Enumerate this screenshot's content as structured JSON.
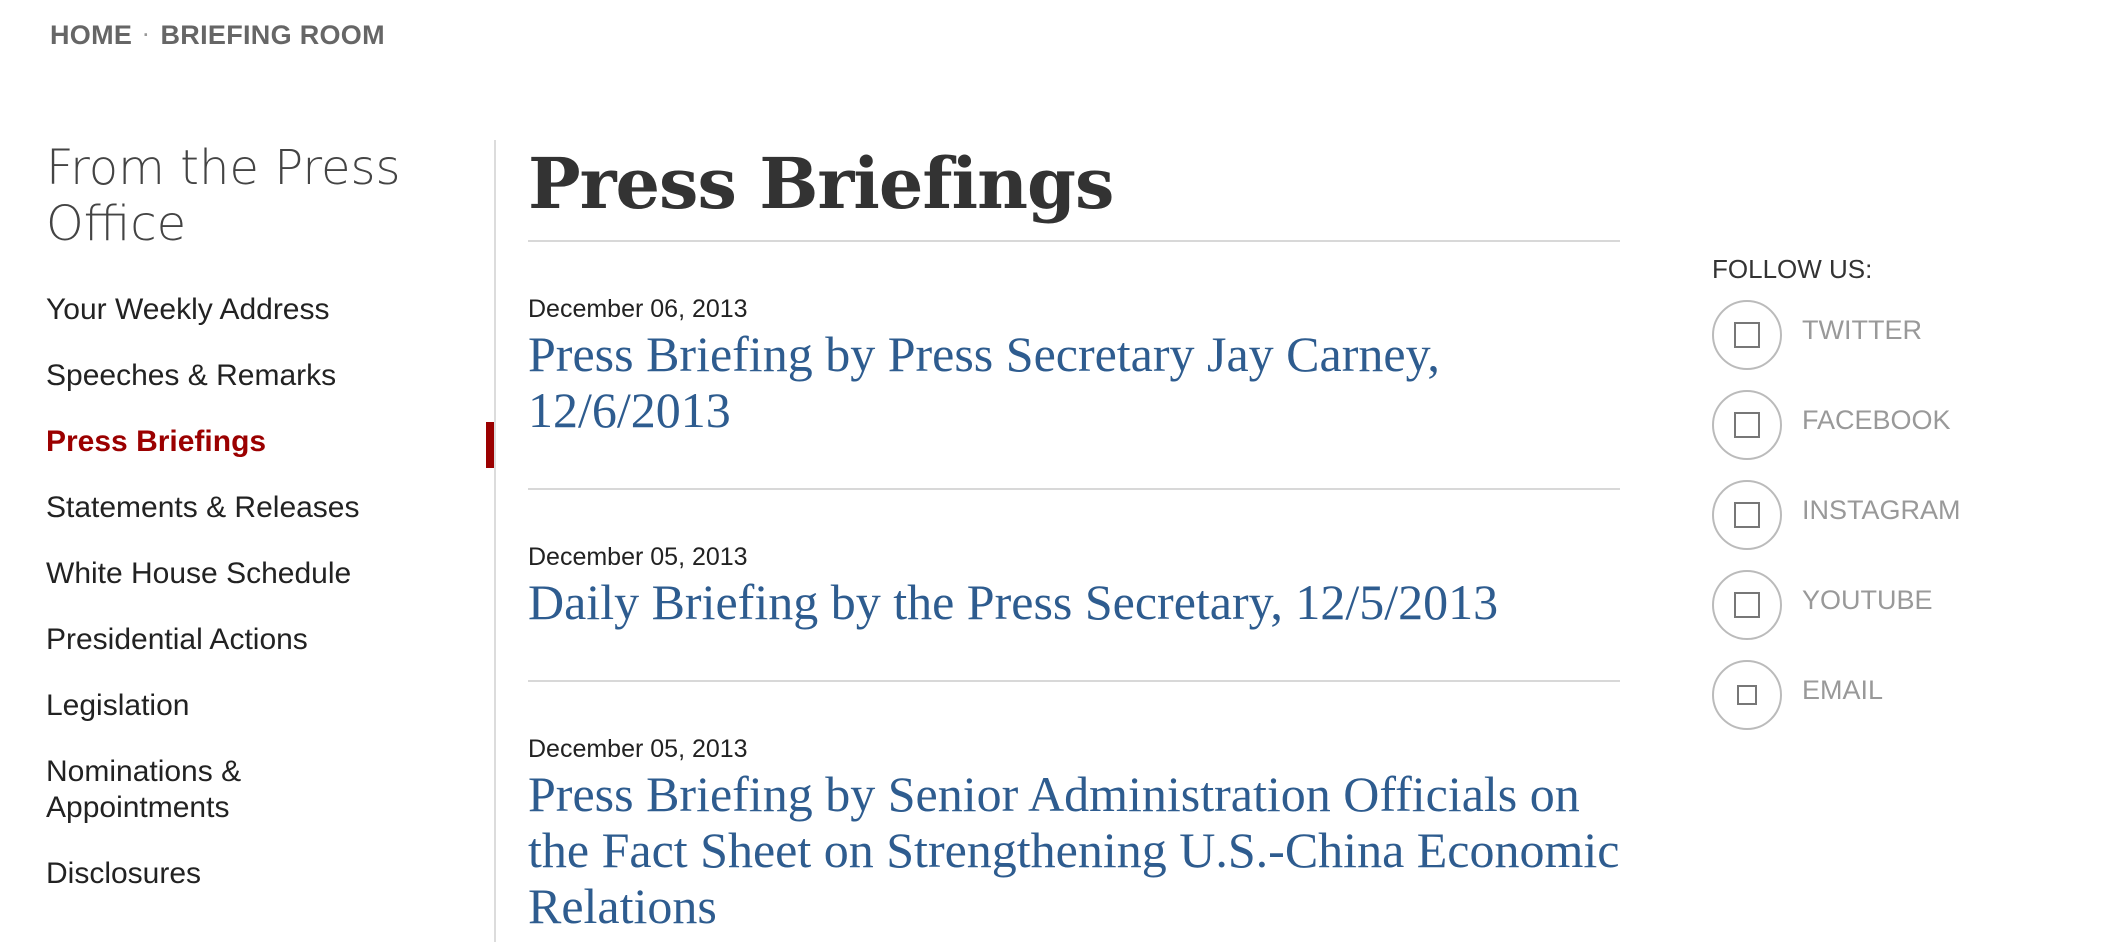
{
  "breadcrumb": {
    "home": "HOME",
    "separator": "·",
    "current": "BRIEFING ROOM"
  },
  "sidebar": {
    "title": "From the Press Office",
    "items": [
      {
        "label": "Your Weekly Address",
        "active": false
      },
      {
        "label": "Speeches & Remarks",
        "active": false
      },
      {
        "label": "Press Briefings",
        "active": true
      },
      {
        "label": "Statements & Releases",
        "active": false
      },
      {
        "label": "White House Schedule",
        "active": false
      },
      {
        "label": "Presidential Actions",
        "active": false
      },
      {
        "label": "Legislation",
        "active": false
      },
      {
        "label": "Nominations & Appointments",
        "active": false
      },
      {
        "label": "Disclosures",
        "active": false
      }
    ]
  },
  "main": {
    "title": "Press Briefings",
    "entries": [
      {
        "date": "December 06, 2013",
        "title": "Press Briefing by Press Secretary Jay Carney, 12/6/2013"
      },
      {
        "date": "December 05, 2013",
        "title": "Daily Briefing by the Press Secretary, 12/5/2013"
      },
      {
        "date": "December 05, 2013",
        "title": "Press Briefing by Senior Administration Officials on the Fact Sheet on Strengthening U.S.-China Economic Relations"
      }
    ]
  },
  "follow": {
    "label": "FOLLOW US:",
    "items": [
      {
        "name": "TWITTER",
        "icon": "twitter-icon"
      },
      {
        "name": "FACEBOOK",
        "icon": "facebook-icon"
      },
      {
        "name": "INSTAGRAM",
        "icon": "instagram-icon"
      },
      {
        "name": "YOUTUBE",
        "icon": "youtube-icon"
      },
      {
        "name": "EMAIL",
        "icon": "email-icon"
      }
    ]
  },
  "colors": {
    "accent": "#9b0000",
    "link": "#2e5c8f",
    "muted": "#999999",
    "rule": "#d8d8d8"
  }
}
